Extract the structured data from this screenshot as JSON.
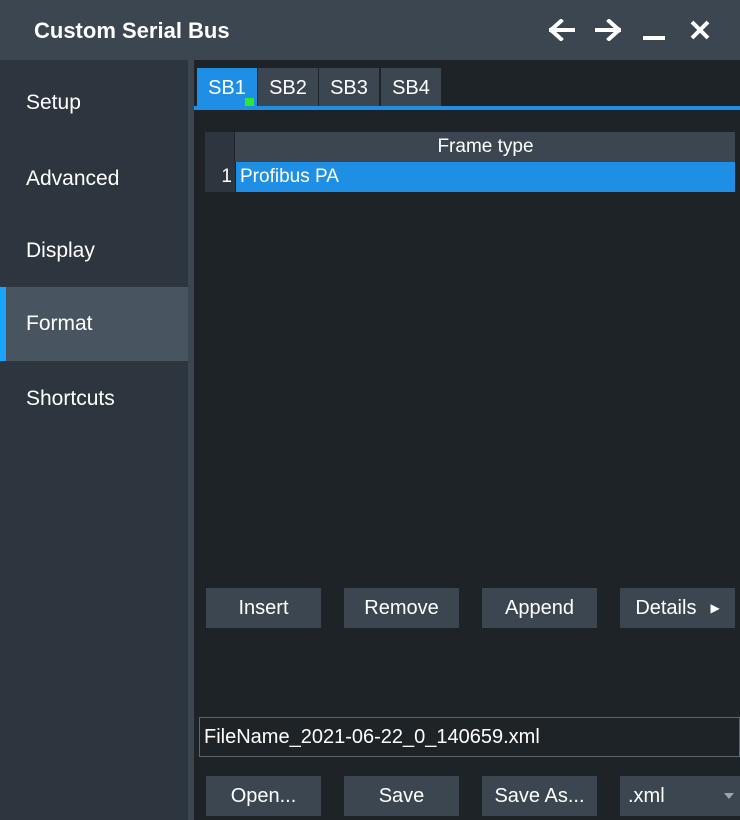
{
  "window": {
    "title": "Custom Serial Bus",
    "icons": [
      "arrow-left-icon",
      "arrow-right-icon",
      "minimize-icon",
      "close-icon"
    ]
  },
  "sidebar": {
    "items": [
      {
        "label": "Setup"
      },
      {
        "label": "Advanced"
      },
      {
        "label": "Display"
      },
      {
        "label": "Format",
        "active": true
      },
      {
        "label": "Shortcuts"
      }
    ]
  },
  "tabs": [
    {
      "label": "SB1",
      "active": true,
      "status": "enabled"
    },
    {
      "label": "SB2"
    },
    {
      "label": "SB3"
    },
    {
      "label": "SB4"
    }
  ],
  "table": {
    "header": "Frame type",
    "rows": [
      {
        "index": "1",
        "value": "Profibus PA",
        "selected": true
      }
    ]
  },
  "actions": {
    "insert": "Insert",
    "remove": "Remove",
    "append": "Append",
    "details": "Details"
  },
  "file": {
    "name": "FileName_2021-06-22_0_140659.xml",
    "open": "Open...",
    "save": "Save",
    "save_as": "Save As...",
    "format": ".xml"
  },
  "colors": {
    "accent": "#1f8fe6",
    "status_green": "#2ee82e",
    "panel": "#3b4650",
    "background": "#1e2327"
  }
}
